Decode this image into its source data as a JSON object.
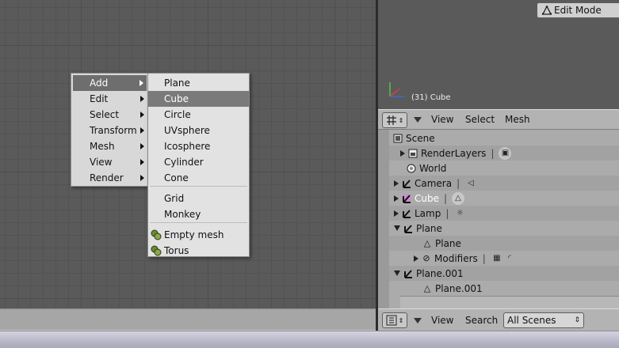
{
  "viewport": {
    "object_label": "(31) Cube"
  },
  "context_menu": {
    "items": [
      {
        "label": "Add"
      },
      {
        "label": "Edit"
      },
      {
        "label": "Select"
      },
      {
        "label": "Transform"
      },
      {
        "label": "Mesh"
      },
      {
        "label": "View"
      },
      {
        "label": "Render"
      }
    ],
    "add_submenu": [
      {
        "label": "Plane"
      },
      {
        "label": "Cube"
      },
      {
        "label": "Circle"
      },
      {
        "label": "UVsphere"
      },
      {
        "label": "Icosphere"
      },
      {
        "label": "Cylinder"
      },
      {
        "label": "Cone"
      },
      {
        "label": "Grid"
      },
      {
        "label": "Monkey"
      },
      {
        "label": "Empty mesh"
      },
      {
        "label": "Torus"
      }
    ]
  },
  "view3d_header": {
    "menus": [
      "View",
      "Select",
      "Mesh"
    ],
    "mode": "Edit Mode"
  },
  "outliner": {
    "rows": [
      {
        "label": "Scene"
      },
      {
        "label": "RenderLayers"
      },
      {
        "label": "World"
      },
      {
        "label": "Camera"
      },
      {
        "label": "Cube"
      },
      {
        "label": "Lamp"
      },
      {
        "label": "Plane"
      },
      {
        "label": "Plane"
      },
      {
        "label": "Modifiers"
      },
      {
        "label": "Plane.001"
      },
      {
        "label": "Plane.001"
      }
    ]
  },
  "outliner_header": {
    "menus": [
      "View",
      "Search"
    ],
    "scenes_select": "All Scenes"
  },
  "colors": {
    "menu_highlight": "#6e6e6e",
    "cube_label": "#ffffff"
  }
}
